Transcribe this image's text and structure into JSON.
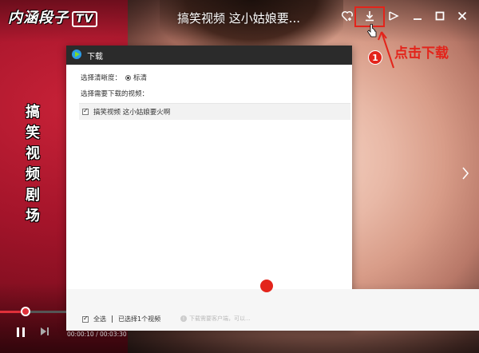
{
  "window": {
    "title": "搞笑视频 这小姑娘要..."
  },
  "video_overlay": {
    "logo_main": "内涵段子",
    "logo_tv": "TV",
    "vertical_title": [
      "搞",
      "笑",
      "视",
      "频",
      "剧",
      "场"
    ]
  },
  "toolbar": {
    "icons": [
      "heart-plus-icon",
      "download-icon",
      "share-icon",
      "minimize-icon",
      "maximize-icon",
      "close-icon"
    ]
  },
  "annotations": {
    "step1_number": "1",
    "step1_text": "点击下载",
    "accent_color": "#e3241b"
  },
  "download_dialog": {
    "title": "下载",
    "quality_label": "选择清晰度：",
    "quality_option": "标清",
    "select_label": "选择需要下载的视频：",
    "videos": [
      {
        "title": "搞笑视频 这小姑娘要火啊",
        "checked": true
      }
    ],
    "select_all_label": "全选",
    "selected_count": "已选择1个视频",
    "hint": "下载需要客户端，可以..."
  },
  "player": {
    "current_time": "00:00:10",
    "total_time": "00:03:30",
    "time_separator": " / ",
    "progress_fraction": 0.05,
    "accent_color": "#e0303a"
  }
}
